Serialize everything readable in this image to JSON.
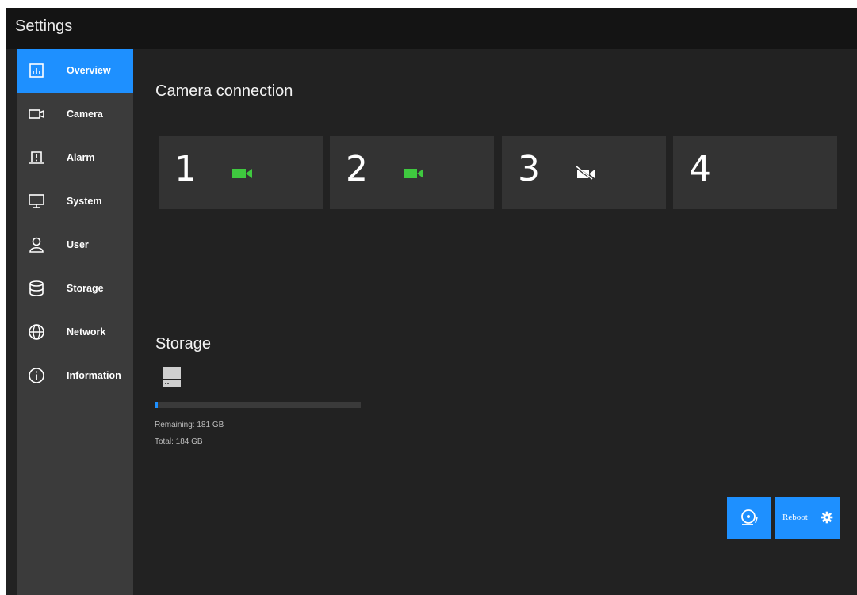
{
  "window": {
    "title": "Settings"
  },
  "sidebar": {
    "items": [
      {
        "label": "Overview",
        "icon": "chart-icon",
        "active": true
      },
      {
        "label": "Camera",
        "icon": "camera-icon",
        "active": false
      },
      {
        "label": "Alarm",
        "icon": "alarm-icon",
        "active": false
      },
      {
        "label": "System",
        "icon": "monitor-icon",
        "active": false
      },
      {
        "label": "User",
        "icon": "user-icon",
        "active": false
      },
      {
        "label": "Storage",
        "icon": "database-icon",
        "active": false
      },
      {
        "label": "Network",
        "icon": "globe-icon",
        "active": false
      },
      {
        "label": "Information",
        "icon": "info-icon",
        "active": false
      }
    ]
  },
  "camera_connection": {
    "title": "Camera connection",
    "cameras": [
      {
        "number": "1",
        "status": "connected",
        "icon": "video-camera-icon"
      },
      {
        "number": "2",
        "status": "connected",
        "icon": "video-camera-icon"
      },
      {
        "number": "3",
        "status": "disconnected",
        "icon": "video-camera-off-icon"
      },
      {
        "number": "4",
        "status": "none"
      }
    ]
  },
  "storage": {
    "title": "Storage",
    "icon": "hard-drive-icon",
    "remaining": "Remaining: 181 GB",
    "total": "Total: 184 GB",
    "used_fraction": 0.016
  },
  "actions": {
    "alarm_icon": "alarm-bell-icon",
    "reboot_label": "Reboot",
    "reboot_icon": "gear-icon"
  },
  "colors": {
    "accent": "#1e90ff",
    "connected": "#3fc93f",
    "disconnected": "#ffffff",
    "background": "#222222",
    "sidebar": "#3b3b3b",
    "titlebar": "#141414",
    "card": "#333333"
  }
}
